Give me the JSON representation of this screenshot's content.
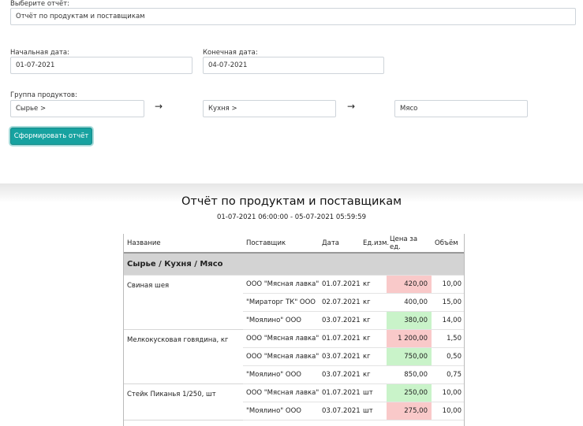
{
  "form": {
    "report_label": "Выберите отчёт:",
    "report_value": "Отчёт по продуктам и поставщикам",
    "start_label": "Начальная дата:",
    "start_value": "01-07-2021",
    "end_label": "Конечная дата:",
    "end_value": "04-07-2021",
    "group_label": "Группа продуктов:",
    "group_level1": "Сырье >",
    "group_level2": "Кухня >",
    "group_level3": "Мясо",
    "arrow": "→",
    "submit_label": "Сформировать отчёт"
  },
  "report": {
    "title": "Отчёт по продуктам и поставщикам",
    "period": "01-07-2021 06:00:00 - 05-07-2021 05:59:59",
    "columns": [
      "Название",
      "Поставщик",
      "Дата",
      "Ед.изм.",
      "Цена за ед.",
      "Объём"
    ],
    "group": "Сырье / Кухня / Мясо",
    "products": [
      {
        "name": "Свиная шея",
        "rows": [
          {
            "supplier": "ООО \"Мясная лавка\"",
            "date": "01.07.2021",
            "unit": "кг",
            "price": "420,00",
            "volume": "10,00",
            "price_flag": "high"
          },
          {
            "supplier": "\"Мираторг ТК\" ООО",
            "date": "02.07.2021",
            "unit": "кг",
            "price": "400,00",
            "volume": "15,00",
            "price_flag": ""
          },
          {
            "supplier": "\"Моялино\" ООО",
            "date": "03.07.2021",
            "unit": "кг",
            "price": "380,00",
            "volume": "14,00",
            "price_flag": "low"
          }
        ]
      },
      {
        "name": "Мелкокусковая говядина, кг",
        "rows": [
          {
            "supplier": "ООО \"Мясная лавка\"",
            "date": "01.07.2021",
            "unit": "кг",
            "price": "1 200,00",
            "volume": "1,50",
            "price_flag": "high"
          },
          {
            "supplier": "ООО \"Мясная лавка\"",
            "date": "03.07.2021",
            "unit": "кг",
            "price": "750,00",
            "volume": "0,50",
            "price_flag": "low"
          },
          {
            "supplier": "\"Моялино\" ООО",
            "date": "03.07.2021",
            "unit": "кг",
            "price": "850,00",
            "volume": "0,75",
            "price_flag": ""
          }
        ]
      },
      {
        "name": "Стейк Пиканья 1/250, шт",
        "rows": [
          {
            "supplier": "ООО \"Мясная лавка\"",
            "date": "01.07.2021",
            "unit": "шт",
            "price": "250,00",
            "volume": "10,00",
            "price_flag": "low"
          },
          {
            "supplier": "\"Моялино\" ООО",
            "date": "03.07.2021",
            "unit": "шт",
            "price": "275,00",
            "volume": "10,00",
            "price_flag": "high"
          }
        ]
      }
    ]
  },
  "colors": {
    "accent": "#17a2a0",
    "price_high": "#f9c9c9",
    "price_low": "#c9f3c9",
    "group_row": "#d3d3d3"
  }
}
